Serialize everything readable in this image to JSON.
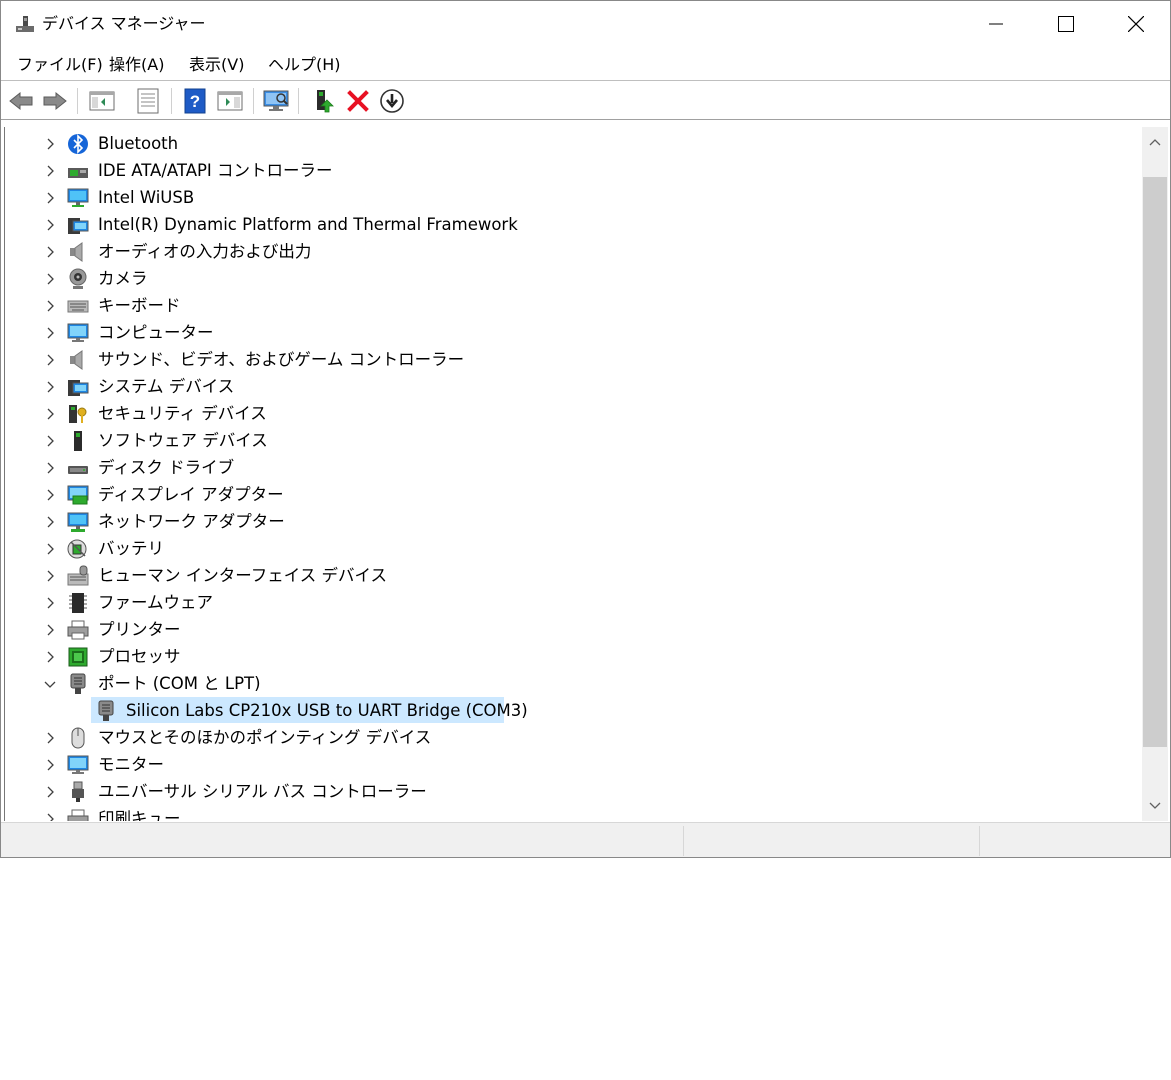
{
  "window": {
    "title": "デバイス マネージャー"
  },
  "menu": [
    {
      "label": "ファイル(F)"
    },
    {
      "label": "操作(A)"
    },
    {
      "label": "表示(V)"
    },
    {
      "label": "ヘルプ(H)"
    }
  ],
  "toolbar": {
    "buttons": [
      {
        "icon": "back-arrow-icon"
      },
      {
        "icon": "forward-arrow-icon"
      },
      {
        "icon": "show-hide-console-tree-icon"
      },
      {
        "icon": "properties-icon"
      },
      {
        "icon": "help-icon"
      },
      {
        "icon": "show-action-pane-icon"
      },
      {
        "icon": "scan-hardware-icon"
      },
      {
        "icon": "update-driver-icon"
      },
      {
        "icon": "uninstall-device-icon"
      },
      {
        "icon": "disable-device-icon"
      }
    ]
  },
  "tree": {
    "items": [
      {
        "label": "Bluetooth",
        "icon": "bluetooth-icon",
        "expanded": false
      },
      {
        "label": "IDE ATA/ATAPI コントローラー",
        "icon": "ide-controller-icon",
        "expanded": false
      },
      {
        "label": "Intel WiUSB",
        "icon": "network-monitor-icon",
        "expanded": false
      },
      {
        "label": "Intel(R) Dynamic Platform and Thermal Framework",
        "icon": "system-device-icon",
        "expanded": false
      },
      {
        "label": "オーディオの入力および出力",
        "icon": "speaker-icon",
        "expanded": false
      },
      {
        "label": "カメラ",
        "icon": "camera-icon",
        "expanded": false
      },
      {
        "label": "キーボード",
        "icon": "keyboard-icon",
        "expanded": false
      },
      {
        "label": "コンピューター",
        "icon": "computer-icon",
        "expanded": false
      },
      {
        "label": "サウンド、ビデオ、およびゲーム コントローラー",
        "icon": "speaker-icon",
        "expanded": false
      },
      {
        "label": "システム デバイス",
        "icon": "system-device-icon",
        "expanded": false
      },
      {
        "label": "セキュリティ デバイス",
        "icon": "security-key-icon",
        "expanded": false
      },
      {
        "label": "ソフトウェア デバイス",
        "icon": "software-device-icon",
        "expanded": false
      },
      {
        "label": "ディスク ドライブ",
        "icon": "disk-drive-icon",
        "expanded": false
      },
      {
        "label": "ディスプレイ アダプター",
        "icon": "display-adapter-icon",
        "expanded": false
      },
      {
        "label": "ネットワーク アダプター",
        "icon": "network-adapter-icon",
        "expanded": false
      },
      {
        "label": "バッテリ",
        "icon": "battery-icon",
        "expanded": false
      },
      {
        "label": "ヒューマン インターフェイス デバイス",
        "icon": "hid-icon",
        "expanded": false
      },
      {
        "label": "ファームウェア",
        "icon": "firmware-chip-icon",
        "expanded": false
      },
      {
        "label": "プリンター",
        "icon": "printer-icon",
        "expanded": false
      },
      {
        "label": "プロセッサ",
        "icon": "processor-icon",
        "expanded": false
      },
      {
        "label": "ポート (COM と LPT)",
        "icon": "port-connector-icon",
        "expanded": true
      },
      {
        "label": "Silicon Labs CP210x USB to UART Bridge (COM3)",
        "icon": "port-connector-icon",
        "child": true,
        "selected": true
      },
      {
        "label": "マウスとそのほかのポインティング デバイス",
        "icon": "mouse-icon",
        "expanded": false
      },
      {
        "label": "モニター",
        "icon": "monitor-icon",
        "expanded": false
      },
      {
        "label": "ユニバーサル シリアル バス コントローラー",
        "icon": "usb-plug-icon",
        "expanded": false
      },
      {
        "label": "印刷キュー",
        "icon": "print-queue-icon",
        "expanded": false
      }
    ]
  },
  "colors": {
    "selection": "#cce8ff",
    "uninstall_red": "#e81123",
    "help_blue": "#1e5bc6",
    "update_green": "#2eaa2e"
  }
}
